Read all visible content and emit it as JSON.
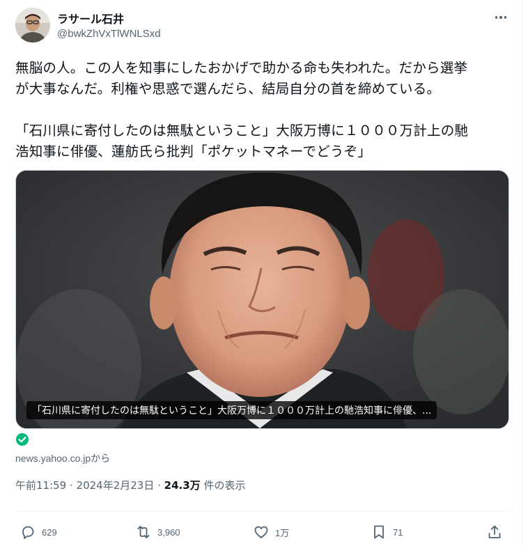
{
  "author": {
    "display_name": "ラサール石井",
    "handle": "@bwkZhVxTlWNLSxd"
  },
  "tweet": {
    "text": "無脳の人。この人を知事にしたおかげで助かる命も失われた。だから選挙\nが大事なんだ。利権や思惑で選んだら、結局自分の首を締めている。\n\n「石川県に寄付したのは無駄ということ」大阪万博に１０００万計上の馳\n浩知事に俳優、蓮舫氏ら批判「ポケットマネーでどうぞ」"
  },
  "card": {
    "caption": "「石川県に寄付したのは無駄ということ」大阪万博に１０００万計上の馳浩知事に俳優、...",
    "source": "news.yahoo.co.jpから"
  },
  "meta": {
    "time": "午前11:59",
    "separator": " · ",
    "date": "2024年2月23日",
    "views_count": "24.3万",
    "views_label": " 件の表示"
  },
  "actions": {
    "reply_count": "629",
    "retweet_count": "3,960",
    "like_count": "1万",
    "bookmark_count": "71"
  },
  "icons": {
    "more": "more-horizontal-icon",
    "reply": "reply-icon",
    "retweet": "retweet-icon",
    "like": "heart-icon",
    "bookmark": "bookmark-icon",
    "share": "share-icon",
    "verified": "check-circle-icon"
  },
  "colors": {
    "text": "#0f1419",
    "secondary": "#536471",
    "verified_green": "#00ba7c"
  }
}
